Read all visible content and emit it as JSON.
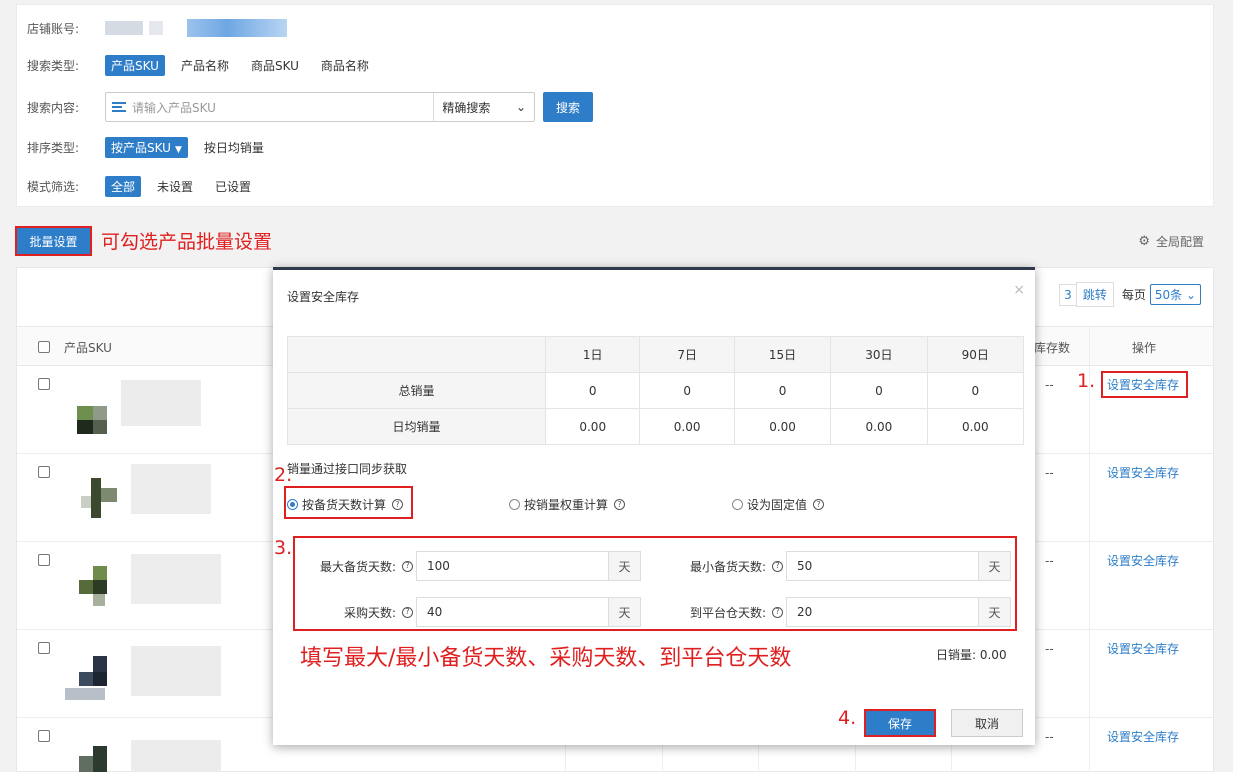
{
  "filters": {
    "store_account_label": "店铺账号:",
    "search_type_label": "搜索类型:",
    "search_types": [
      "产品SKU",
      "产品名称",
      "商品SKU",
      "商品名称"
    ],
    "search_content_label": "搜索内容:",
    "search_placeholder": "请输入产品SKU",
    "search_mode": "精确搜索",
    "search_button": "搜索",
    "sort_type_label": "排序类型:",
    "sort_primary": "按产品SKU",
    "sort_secondary": "按日均销量",
    "mode_filter_label": "模式筛选:",
    "mode_options": [
      "全部",
      "未设置",
      "已设置"
    ]
  },
  "toolbar": {
    "bulk_button": "批量设置",
    "bulk_note": "可勾选产品批量设置",
    "global_config": "全局配置"
  },
  "pager": {
    "page_fragment": "3",
    "jump": "跳转",
    "per_page_label": "每页",
    "per_page_value": "50条"
  },
  "table": {
    "col_sku": "产品SKU",
    "col_stock": "成库存数",
    "col_op": "操作",
    "rows": [
      {
        "dash": "--",
        "op": "设置安全库存"
      },
      {
        "dash": "--",
        "op": "设置安全库存"
      },
      {
        "dash": "--",
        "op": "设置安全库存"
      },
      {
        "dash": "--",
        "op": "设置安全库存"
      },
      {
        "dash": "--",
        "op": "设置安全库存"
      }
    ]
  },
  "annotations": {
    "step1": "1.",
    "step2": "2.",
    "step3": "3.",
    "step4": "4.",
    "fill_note": "填写最大/最小备货天数、采购天数、到平台仓天数"
  },
  "modal": {
    "title": "设置安全库存",
    "close": "×",
    "periods": [
      "1日",
      "7日",
      "15日",
      "30日",
      "90日"
    ],
    "total_sales_label": "总销量",
    "total_sales": [
      "0",
      "0",
      "0",
      "0",
      "0"
    ],
    "daily_sales_label": "日均销量",
    "daily_sales": [
      "0.00",
      "0.00",
      "0.00",
      "0.00",
      "0.00"
    ],
    "sync_note": "销量通过接口同步获取",
    "modes": [
      "按备货天数计算",
      "按销量权重计算",
      "设为固定值"
    ],
    "max_stock_days_label": "最大备货天数:",
    "max_stock_days": "100",
    "min_stock_days_label": "最小备货天数:",
    "min_stock_days": "50",
    "purchase_days_label": "采购天数:",
    "purchase_days": "40",
    "warehouse_days_label": "到平台仓天数:",
    "warehouse_days": "20",
    "unit": "天",
    "daily_sales_summary": "日销量: 0.00",
    "save": "保存",
    "cancel": "取消"
  }
}
